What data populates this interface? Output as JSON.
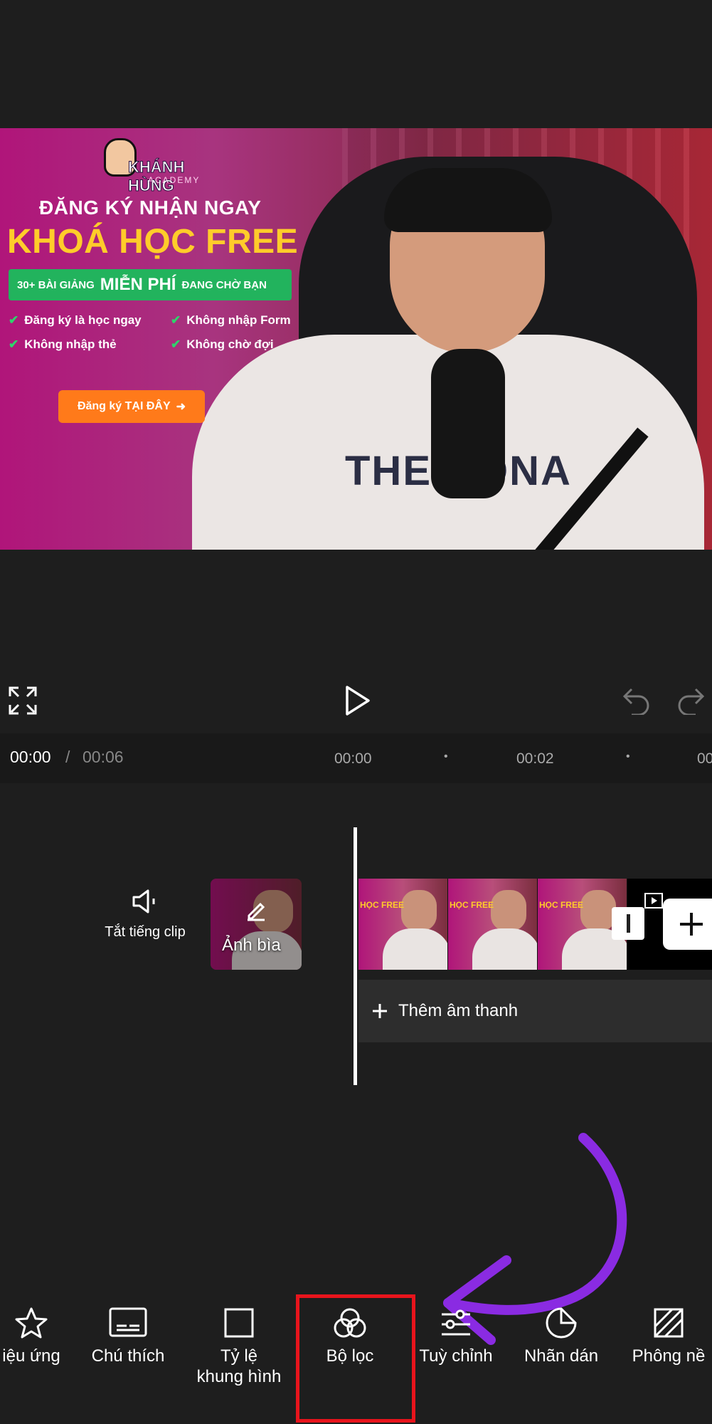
{
  "preview": {
    "logo_name": "KHÁNH HÙNG",
    "logo_sub": "ACADEMY",
    "headline1": "ĐĂNG KÝ NHẬN NGAY",
    "headline2": "KHOÁ HỌC FREE",
    "banner_a": "30+ BÀI GIẢNG",
    "banner_b": "MIỄN PHÍ",
    "banner_c": "ĐANG CHỜ BẠN",
    "checks": [
      "Đăng ký là học ngay",
      "Không nhập Form",
      "Không nhập thẻ",
      "Không chờ đợi"
    ],
    "cta": "Đăng ký TẠI ĐÂY",
    "hoodie_text": "THE UONA"
  },
  "timebar": {
    "current": "00:00",
    "separator": "/",
    "total": "00:06",
    "ticks": [
      "00:00",
      "00:02",
      "00"
    ]
  },
  "timeline": {
    "mute_label": "Tắt tiếng clip",
    "cover_label": "Ảnh bìa",
    "add_audio": "Thêm âm thanh"
  },
  "toolbar": {
    "effects": "iệu ứng",
    "captions": "Chú thích",
    "ratio_line1": "Tỷ lệ",
    "ratio_line2": "khung hình",
    "filters": "Bộ lọc",
    "adjust": "Tuỳ chỉnh",
    "stickers": "Nhãn dán",
    "background": "Phông nề"
  },
  "colors": {
    "highlight_box": "#e8141c",
    "arrow": "#8a2be2"
  }
}
